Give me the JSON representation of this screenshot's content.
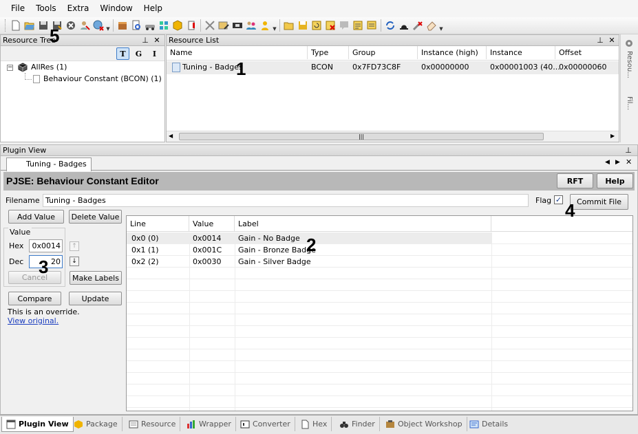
{
  "menu": [
    "File",
    "Tools",
    "Extra",
    "Window",
    "Help"
  ],
  "resource_tree": {
    "title": "Resource Tree",
    "filter_buttons": [
      "T",
      "G",
      "I"
    ],
    "root": "AllRes (1)",
    "child": "Behaviour Constant (BCON) (1)"
  },
  "resource_list": {
    "title": "Resource List",
    "columns": [
      "Name",
      "Type",
      "Group",
      "Instance (high)",
      "Instance",
      "Offset"
    ],
    "rows": [
      {
        "name": "Tuning - Badges",
        "type": "BCON",
        "group": "0x7FD73C8F",
        "instance_high": "0x00000000",
        "instance": "0x00001003 (40...",
        "offset": "0x00000060"
      }
    ]
  },
  "side_panel": {
    "label1": "Resou...",
    "label2": "Fil..."
  },
  "plugin_view": {
    "title": "Plugin View",
    "tab": "Tuning - Badges",
    "editor_title": "PJSE: Behaviour Constant Editor",
    "rft_label": "RFT",
    "help_label": "Help",
    "filename_label": "Filename",
    "filename_value": "Tuning - Badges",
    "flag_label": "Flag",
    "flag_checked": true,
    "commit_label": "Commit File",
    "add_value_label": "Add Value",
    "delete_value_label": "Delete Value",
    "value_group_label": "Value",
    "hex_label": "Hex",
    "hex_value": "0x0014",
    "dec_label": "Dec",
    "dec_value": "20",
    "cancel_label": "Cancel",
    "make_labels_label": "Make Labels",
    "compare_label": "Compare",
    "update_label": "Update",
    "override_text": "This is an override.",
    "view_original_link": "View original.",
    "table": {
      "columns": [
        "Line",
        "Value",
        "Label"
      ],
      "rows": [
        {
          "line": "0x0 (0)",
          "value": "0x0014",
          "label": "Gain - No Badge"
        },
        {
          "line": "0x1 (1)",
          "value": "0x001C",
          "label": "Gain - Bronze Badge"
        },
        {
          "line": "0x2 (2)",
          "value": "0x0030",
          "label": "Gain - Silver Badge"
        }
      ]
    }
  },
  "annotations": [
    "1",
    "2",
    "3",
    "4",
    "5"
  ],
  "bottom_tabs": [
    "Plugin View",
    "Package",
    "Resource",
    "Wrapper",
    "Converter",
    "Hex",
    "Finder",
    "Object Workshop",
    "Details"
  ]
}
